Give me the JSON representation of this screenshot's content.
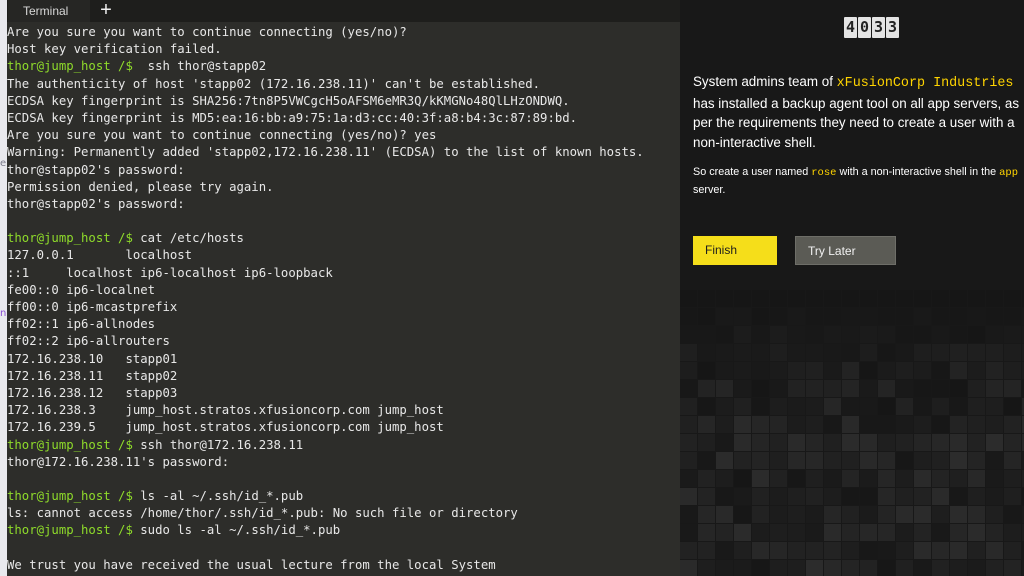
{
  "terminal": {
    "tab_label": "Terminal",
    "add_tab_symbol": "+",
    "lines": [
      {
        "prompt": "",
        "text": "Are you sure you want to continue connecting (yes/no)?"
      },
      {
        "prompt": "",
        "text": "Host key verification failed."
      },
      {
        "prompt": "thor@jump_host /$",
        "text": "  ssh thor@stapp02"
      },
      {
        "prompt": "",
        "text": "The authenticity of host 'stapp02 (172.16.238.11)' can't be established."
      },
      {
        "prompt": "",
        "text": "ECDSA key fingerprint is SHA256:7tn8P5VWCgcH5oAFSM6eMR3Q/kKMGNo48QlLHzONDWQ."
      },
      {
        "prompt": "",
        "text": "ECDSA key fingerprint is MD5:ea:16:bb:a9:75:1a:d3:cc:40:3f:a8:b4:3c:87:89:bd."
      },
      {
        "prompt": "",
        "text": "Are you sure you want to continue connecting (yes/no)? yes"
      },
      {
        "prompt": "",
        "text": "Warning: Permanently added 'stapp02,172.16.238.11' (ECDSA) to the list of known hosts."
      },
      {
        "prompt": "",
        "text": "thor@stapp02's password:"
      },
      {
        "prompt": "",
        "text": "Permission denied, please try again."
      },
      {
        "prompt": "",
        "text": "thor@stapp02's password:"
      },
      {
        "prompt": "",
        "text": ""
      },
      {
        "prompt": "thor@jump_host /$",
        "text": " cat /etc/hosts"
      },
      {
        "prompt": "",
        "text": "127.0.0.1       localhost"
      },
      {
        "prompt": "",
        "text": "::1     localhost ip6-localhost ip6-loopback"
      },
      {
        "prompt": "",
        "text": "fe00::0 ip6-localnet"
      },
      {
        "prompt": "",
        "text": "ff00::0 ip6-mcastprefix"
      },
      {
        "prompt": "",
        "text": "ff02::1 ip6-allnodes"
      },
      {
        "prompt": "",
        "text": "ff02::2 ip6-allrouters"
      },
      {
        "prompt": "",
        "text": "172.16.238.10   stapp01"
      },
      {
        "prompt": "",
        "text": "172.16.238.11   stapp02"
      },
      {
        "prompt": "",
        "text": "172.16.238.12   stapp03"
      },
      {
        "prompt": "",
        "text": "172.16.238.3    jump_host.stratos.xfusioncorp.com jump_host"
      },
      {
        "prompt": "",
        "text": "172.16.239.5    jump_host.stratos.xfusioncorp.com jump_host"
      },
      {
        "prompt": "thor@jump_host /$",
        "text": " ssh thor@172.16.238.11"
      },
      {
        "prompt": "",
        "text": "thor@172.16.238.11's password:"
      },
      {
        "prompt": "",
        "text": ""
      },
      {
        "prompt": "thor@jump_host /$",
        "text": " ls -al ~/.ssh/id_*.pub"
      },
      {
        "prompt": "",
        "text": "ls: cannot access /home/thor/.ssh/id_*.pub: No such file or directory"
      },
      {
        "prompt": "thor@jump_host /$",
        "text": " sudo ls -al ~/.ssh/id_*.pub"
      },
      {
        "prompt": "",
        "text": ""
      },
      {
        "prompt": "",
        "text": "We trust you have received the usual lecture from the local System"
      }
    ]
  },
  "edge_glyphs": [
    "e",
    "n"
  ],
  "task_panel": {
    "counter_digits": [
      "4",
      "0",
      "3",
      "3"
    ],
    "desc_part1": "System admins team of ",
    "desc_company": "xFusionCorp Industries",
    "desc_part2": " has installed a backup agent tool on all app servers, as per the requirements they need to create a user with a non-interactive shell.",
    "task_part1": "So create a user named ",
    "task_user": "rose",
    "task_part2": " with a non-interactive shell in the ",
    "task_server": "app",
    "task_part3": " server.",
    "finish_label": "Finish",
    "later_label": "Try Later",
    "colors": {
      "accent": "#f5de1a",
      "prompt": "#8fdc2a",
      "terminal_bg": "#2d2d2a",
      "panel_bg": "#181818"
    }
  }
}
